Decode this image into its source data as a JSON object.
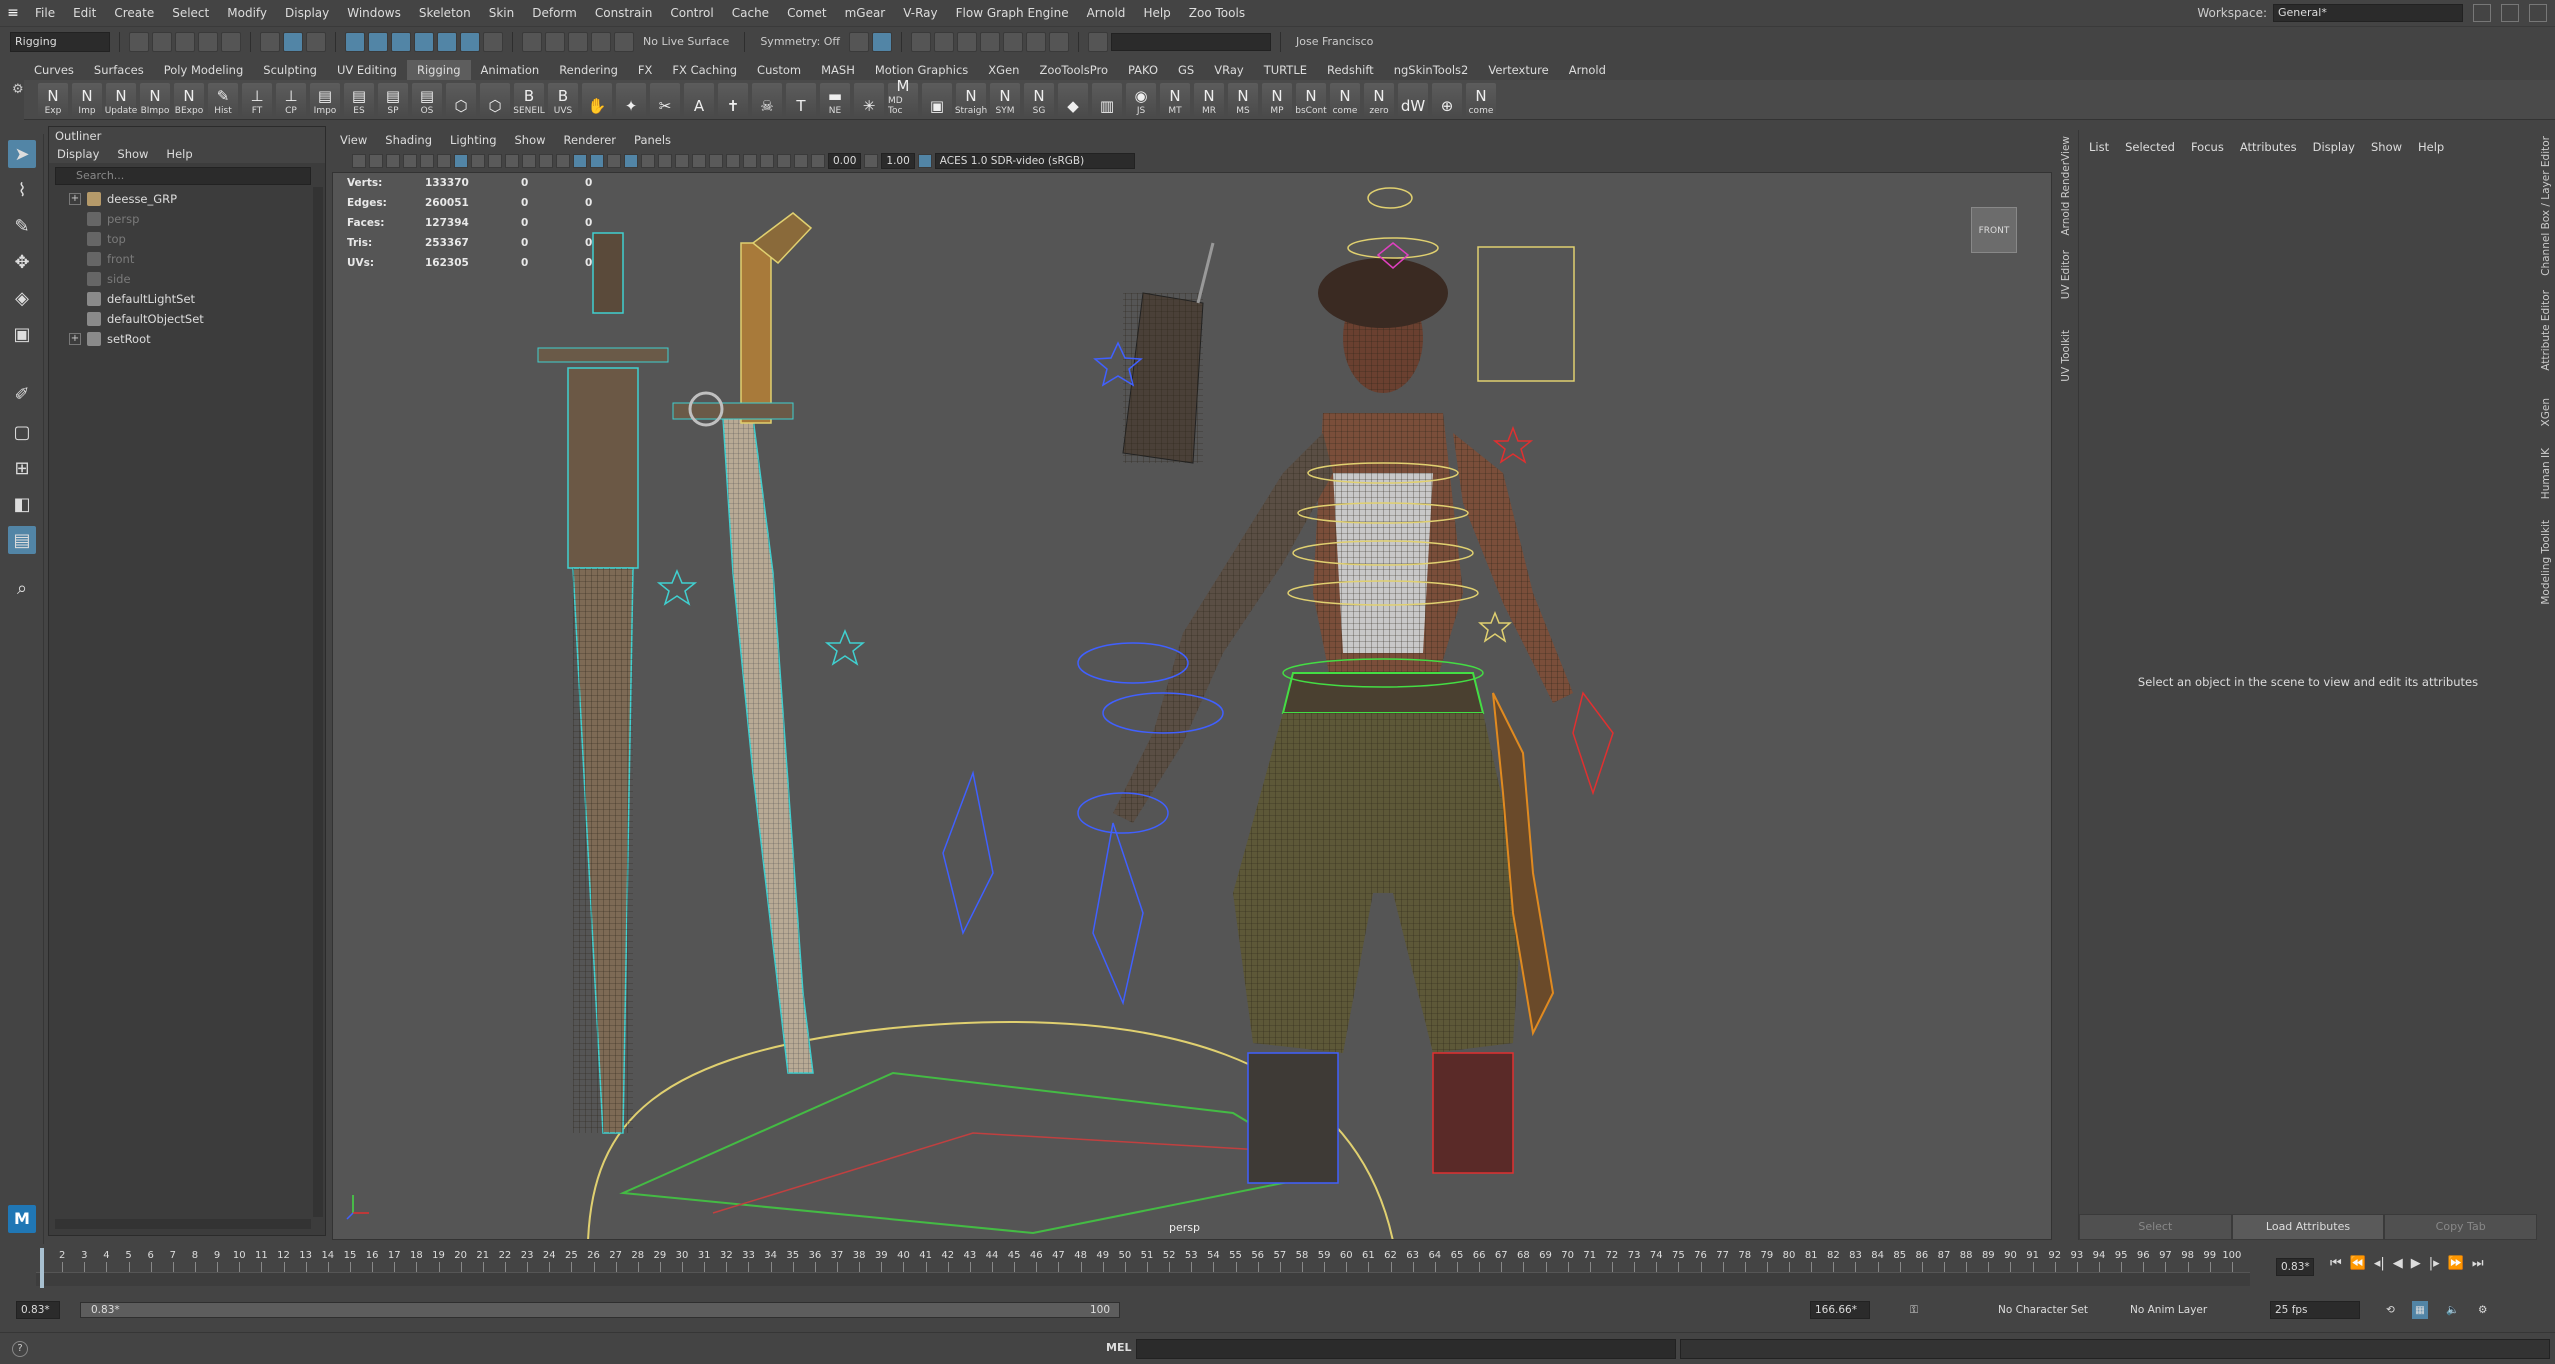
{
  "menubar": {
    "items": [
      "File",
      "Edit",
      "Create",
      "Select",
      "Modify",
      "Display",
      "Windows",
      "Skeleton",
      "Skin",
      "Deform",
      "Constrain",
      "Control",
      "Cache",
      "Comet",
      "mGear",
      "V-Ray",
      "Flow Graph Engine",
      "Arnold",
      "Help",
      "Zoo Tools"
    ],
    "workspace_label": "Workspace:",
    "workspace_value": "General*"
  },
  "statusline": {
    "mode": "Rigging",
    "live_surface": "No Live Surface",
    "symmetry": "Symmetry: Off",
    "user": "Jose Francisco"
  },
  "shelf": {
    "tabs": [
      "Curves",
      "Surfaces",
      "Poly Modeling",
      "Sculpting",
      "UV Editing",
      "Rigging",
      "Animation",
      "Rendering",
      "FX",
      "FX Caching",
      "Custom",
      "MASH",
      "Motion Graphics",
      "XGen",
      "ZooToolsPro",
      "PAKO",
      "GS",
      "VRay",
      "TURTLE",
      "Redshift",
      "ngSkinTools2",
      "Vertexture",
      "Arnold"
    ],
    "active_tab": "Rigging",
    "buttons": [
      {
        "label": "Exp",
        "glyph": "N"
      },
      {
        "label": "Imp",
        "glyph": "N"
      },
      {
        "label": "Update",
        "glyph": "N"
      },
      {
        "label": "BImpo",
        "glyph": "N"
      },
      {
        "label": "BExpo",
        "glyph": "N"
      },
      {
        "label": "Hist",
        "glyph": "✎"
      },
      {
        "label": "FT",
        "glyph": "⊥"
      },
      {
        "label": "CP",
        "glyph": "⊥"
      },
      {
        "label": "Impo",
        "glyph": "▤"
      },
      {
        "label": "ES",
        "glyph": "▤"
      },
      {
        "label": "SP",
        "glyph": "▤"
      },
      {
        "label": "OS",
        "glyph": "▤"
      },
      {
        "label": "",
        "glyph": "⬡"
      },
      {
        "label": "",
        "glyph": "⬡"
      },
      {
        "label": "SENEIL",
        "glyph": "B"
      },
      {
        "label": "UVS",
        "glyph": "B"
      },
      {
        "label": "",
        "glyph": "✋"
      },
      {
        "label": "",
        "glyph": "✦"
      },
      {
        "label": "",
        "glyph": "✂"
      },
      {
        "label": "",
        "glyph": "A"
      },
      {
        "label": "",
        "glyph": "✝"
      },
      {
        "label": "",
        "glyph": "☠"
      },
      {
        "label": "",
        "glyph": "T"
      },
      {
        "label": "NE",
        "glyph": "▬"
      },
      {
        "label": "",
        "glyph": "✳"
      },
      {
        "label": "MD Toc",
        "glyph": "M"
      },
      {
        "label": "",
        "glyph": "▣"
      },
      {
        "label": "Straigh",
        "glyph": "N"
      },
      {
        "label": "SYM",
        "glyph": "N"
      },
      {
        "label": "SG",
        "glyph": "N"
      },
      {
        "label": "",
        "glyph": "◆"
      },
      {
        "label": "",
        "glyph": "▥"
      },
      {
        "label": "JS",
        "glyph": "◉"
      },
      {
        "label": "MT",
        "glyph": "N"
      },
      {
        "label": "MR",
        "glyph": "N"
      },
      {
        "label": "MS",
        "glyph": "N"
      },
      {
        "label": "MP",
        "glyph": "N"
      },
      {
        "label": "bsCont",
        "glyph": "N"
      },
      {
        "label": "come",
        "glyph": "N"
      },
      {
        "label": "zero",
        "glyph": "N"
      },
      {
        "label": "",
        "glyph": "dW"
      },
      {
        "label": "",
        "glyph": "⊕"
      },
      {
        "label": "come",
        "glyph": "N"
      }
    ]
  },
  "outliner": {
    "title": "Outliner",
    "menus": [
      "Display",
      "Show",
      "Help"
    ],
    "search_placeholder": "Search...",
    "items": [
      {
        "label": "deesse_GRP",
        "expandable": true,
        "dim": false,
        "icon_color": "#b59a6a"
      },
      {
        "label": "persp",
        "expandable": false,
        "dim": true,
        "icon_color": "#666666"
      },
      {
        "label": "top",
        "expandable": false,
        "dim": true,
        "icon_color": "#666666"
      },
      {
        "label": "front",
        "expandable": false,
        "dim": true,
        "icon_color": "#666666"
      },
      {
        "label": "side",
        "expandable": false,
        "dim": true,
        "icon_color": "#666666"
      },
      {
        "label": "defaultLightSet",
        "expandable": false,
        "dim": false,
        "icon_color": "#8a8a8a"
      },
      {
        "label": "defaultObjectSet",
        "expandable": false,
        "dim": false,
        "icon_color": "#8a8a8a"
      },
      {
        "label": "setRoot",
        "expandable": true,
        "dim": false,
        "icon_color": "#8a8a8a"
      }
    ]
  },
  "viewport": {
    "menus": [
      "View",
      "Shading",
      "Lighting",
      "Show",
      "Renderer",
      "Panels"
    ],
    "exposure": "0.00",
    "gamma": "1.00",
    "colorspace": "ACES 1.0 SDR-video (sRGB)",
    "hud": [
      {
        "label": "Verts:",
        "value": "133370",
        "sel": "0",
        "comp": "0"
      },
      {
        "label": "Edges:",
        "value": "260051",
        "sel": "0",
        "comp": "0"
      },
      {
        "label": "Faces:",
        "value": "127394",
        "sel": "0",
        "comp": "0"
      },
      {
        "label": "Tris:",
        "value": "253367",
        "sel": "0",
        "comp": "0"
      },
      {
        "label": "UVs:",
        "value": "162305",
        "sel": "0",
        "comp": "0"
      }
    ],
    "viewcube_label": "FRONT",
    "camera": "persp"
  },
  "attribute_editor": {
    "menus": [
      "List",
      "Selected",
      "Focus",
      "Attributes",
      "Display",
      "Show",
      "Help"
    ],
    "message": "Select an object in the scene to view and edit its attributes",
    "buttons": [
      "Select",
      "Load Attributes",
      "Copy Tab"
    ]
  },
  "side_tabs_left": [
    "Arnold RenderView",
    "UV Editor",
    "UV Toolkit"
  ],
  "side_tabs_right": [
    "Channel Box / Layer Editor",
    "Attribute Editor",
    "XGen",
    "Human IK",
    "Modeling Toolkit"
  ],
  "timeline": {
    "start": 1,
    "end": 100,
    "current_frame": "0.83*"
  },
  "range": {
    "start": "0.83*",
    "inner_start": "0.83*",
    "inner_end": "100",
    "end": "166.66*",
    "character_set": "No Character Set",
    "anim_layer": "No Anim Layer",
    "fps": "25 fps"
  },
  "cmdline": {
    "label": "MEL"
  }
}
